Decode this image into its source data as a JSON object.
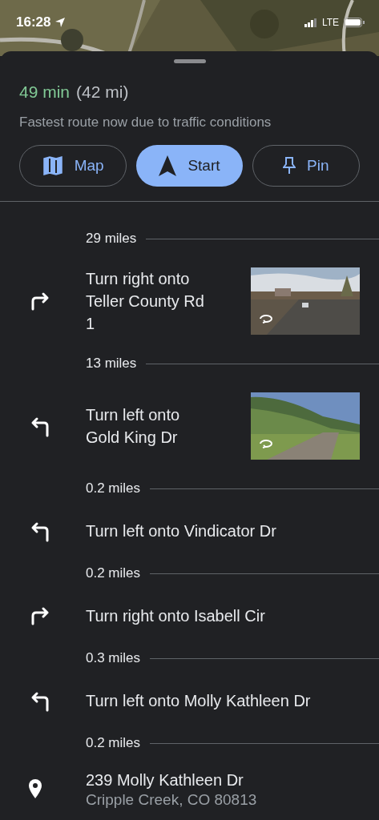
{
  "status_bar": {
    "time": "16:28",
    "network": "LTE"
  },
  "summary": {
    "duration": "49 min",
    "distance": "(42 mi)",
    "note": "Fastest route now due to traffic conditions"
  },
  "actions": [
    {
      "label": "Map",
      "kind": "map",
      "selected": false
    },
    {
      "label": "Start",
      "kind": "navigate",
      "selected": true
    },
    {
      "label": "Pin",
      "kind": "pin",
      "selected": false
    }
  ],
  "steps": [
    {
      "kind": "distance",
      "text": "29 miles"
    },
    {
      "kind": "turn-right",
      "text": "Turn right onto Teller County Rd 1",
      "photo": true
    },
    {
      "kind": "distance",
      "text": "13 miles"
    },
    {
      "kind": "turn-left",
      "text": "Turn left onto Gold King Dr",
      "photo": true
    },
    {
      "kind": "distance",
      "text": "0.2 miles"
    },
    {
      "kind": "turn-left",
      "text": "Turn left onto Vindicator Dr",
      "photo": false
    },
    {
      "kind": "distance",
      "text": "0.2 miles"
    },
    {
      "kind": "turn-right",
      "text": "Turn right onto Isabell Cir",
      "photo": false
    },
    {
      "kind": "distance",
      "text": "0.3 miles"
    },
    {
      "kind": "turn-left",
      "text": "Turn left onto Molly Kathleen Dr",
      "photo": false
    },
    {
      "kind": "distance",
      "text": "0.2 miles"
    },
    {
      "kind": "destination",
      "text": "239 Molly Kathleen Dr",
      "subtext": "Cripple Creek, CO 80813"
    }
  ]
}
